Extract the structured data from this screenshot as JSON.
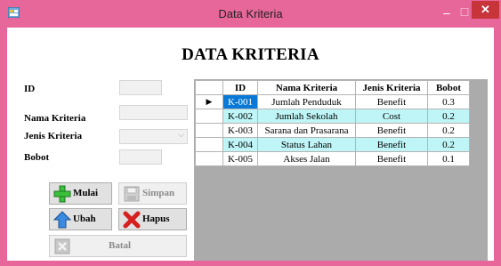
{
  "window": {
    "title": "Data Kriteria",
    "minimize_glyph": "–",
    "maximize_glyph": "☐",
    "close_glyph": "✕",
    "titlebar_color": "#e8679a",
    "close_color": "#c7343a"
  },
  "heading": "DATA KRITERIA",
  "form": {
    "id_label": "ID",
    "nama_label": "Nama Kriteria",
    "jenis_label": "Jenis Kriteria",
    "bobot_label": "Bobot",
    "id_value": "",
    "nama_value": "",
    "jenis_value": "",
    "bobot_value": ""
  },
  "buttons": {
    "mulai": "Mulai",
    "simpan": "Simpan",
    "ubah": "Ubah",
    "hapus": "Hapus",
    "batal": "Batal"
  },
  "table": {
    "columns": [
      "ID",
      "Nama Kriteria",
      "Jenis Kriteria",
      "Bobot"
    ],
    "current_row_marker": "▶",
    "rows": [
      [
        "K-001",
        "Jumlah Penduduk",
        "Benefit",
        "0.3"
      ],
      [
        "K-002",
        "Jumlah Sekolah",
        "Cost",
        "0.2"
      ],
      [
        "K-003",
        "Sarana dan Prasarana",
        "Benefit",
        "0.2"
      ],
      [
        "K-004",
        "Status Lahan",
        "Benefit",
        "0.2"
      ],
      [
        "K-005",
        "Akses Jalan",
        "Benefit",
        "0.1"
      ]
    ],
    "alt_row_color": "#bff5f6",
    "selected_cell_color": "#0a78d7"
  },
  "icons": {
    "app": "app-window-icon",
    "mulai": "green-plus-icon",
    "simpan": "save-disk-icon",
    "ubah": "blue-up-arrow-icon",
    "hapus": "red-x-icon",
    "batal": "cancel-x-icon"
  }
}
